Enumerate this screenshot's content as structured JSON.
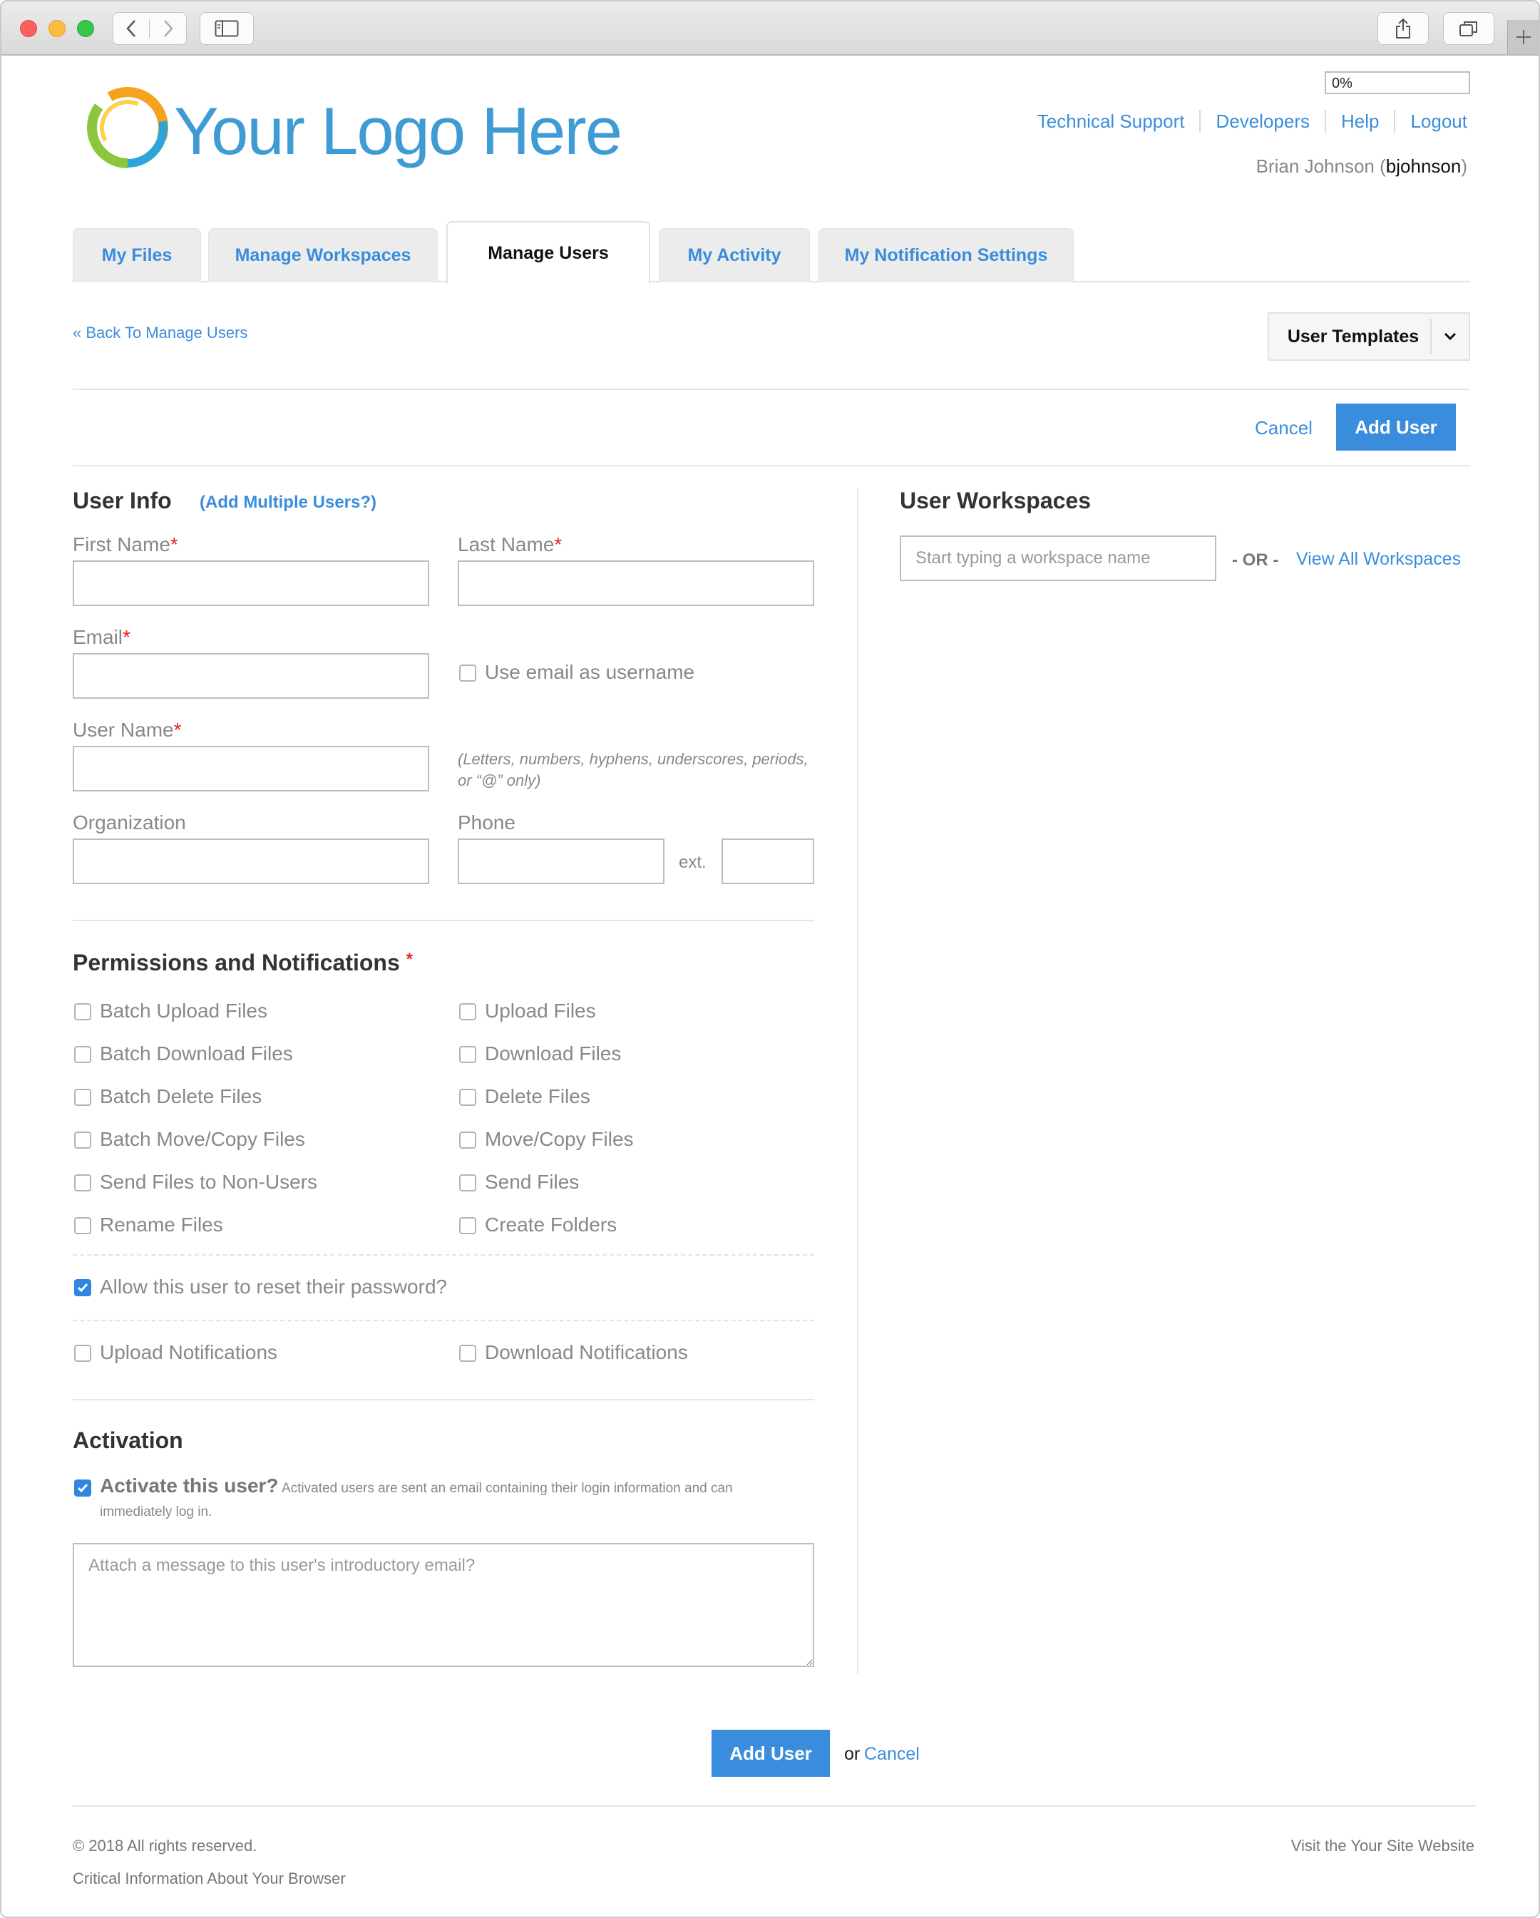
{
  "header": {
    "logo_text": "Your Logo Here",
    "progress_label": "0%",
    "links": [
      "Technical Support",
      "Developers",
      "Help",
      "Logout"
    ],
    "user_full_name": "Brian Johnson",
    "user_open_paren": " (",
    "user_name": "bjohnson",
    "user_close_paren": ")"
  },
  "tabs": [
    {
      "label": "My Files"
    },
    {
      "label": "Manage Workspaces"
    },
    {
      "label": "Manage Users"
    },
    {
      "label": "My Activity"
    },
    {
      "label": "My Notification Settings"
    }
  ],
  "subheader": {
    "back_link": "« Back To Manage Users",
    "user_templates": "User Templates",
    "cancel": "Cancel",
    "add_user": "Add User"
  },
  "user_info": {
    "title": "User Info",
    "add_multiple": "(Add Multiple Users?)",
    "first_name_label": "First Name",
    "last_name_label": "Last Name",
    "email_label": "Email",
    "use_email_username": "Use email as username",
    "user_name_label": "User Name",
    "user_name_hint": "(Letters, numbers, hyphens, underscores, periods, or “@” only)",
    "organization_label": "Organization",
    "phone_label": "Phone",
    "ext_label": "ext.",
    "required_mark": "*"
  },
  "workspaces": {
    "title": "User Workspaces",
    "search_placeholder": "Start typing a workspace name",
    "or_text": "- OR -",
    "view_all": "View All Workspaces"
  },
  "permissions": {
    "title": "Permissions and Notifications",
    "left": [
      "Batch Upload Files",
      "Batch Download Files",
      "Batch Delete Files",
      "Batch Move/Copy Files",
      "Send Files to Non-Users",
      "Rename Files"
    ],
    "right": [
      "Upload Files",
      "Download Files",
      "Delete Files",
      "Move/Copy Files",
      "Send Files",
      "Create Folders"
    ],
    "reset_password": "Allow this user to reset their password?",
    "upload_notifications": "Upload Notifications",
    "download_notifications": "Download Notifications"
  },
  "activation": {
    "title": "Activation",
    "activate_label": "Activate this user?",
    "activate_desc_1": "Activated users are sent an email containing their login information and can",
    "activate_desc_2": "immediately log in.",
    "message_placeholder": "Attach a message to this user's introductory email?"
  },
  "bottom": {
    "add_user": "Add User",
    "or": "or",
    "cancel": "Cancel"
  },
  "footer": {
    "copyright": "© 2018 All rights reserved.",
    "critical_info": "Critical Information About Your Browser",
    "visit_site": "Visit the Your Site Website"
  },
  "colors": {
    "accent": "#3a8ddd",
    "required": "#e02424",
    "checkbox_on": "#2f86e0"
  }
}
